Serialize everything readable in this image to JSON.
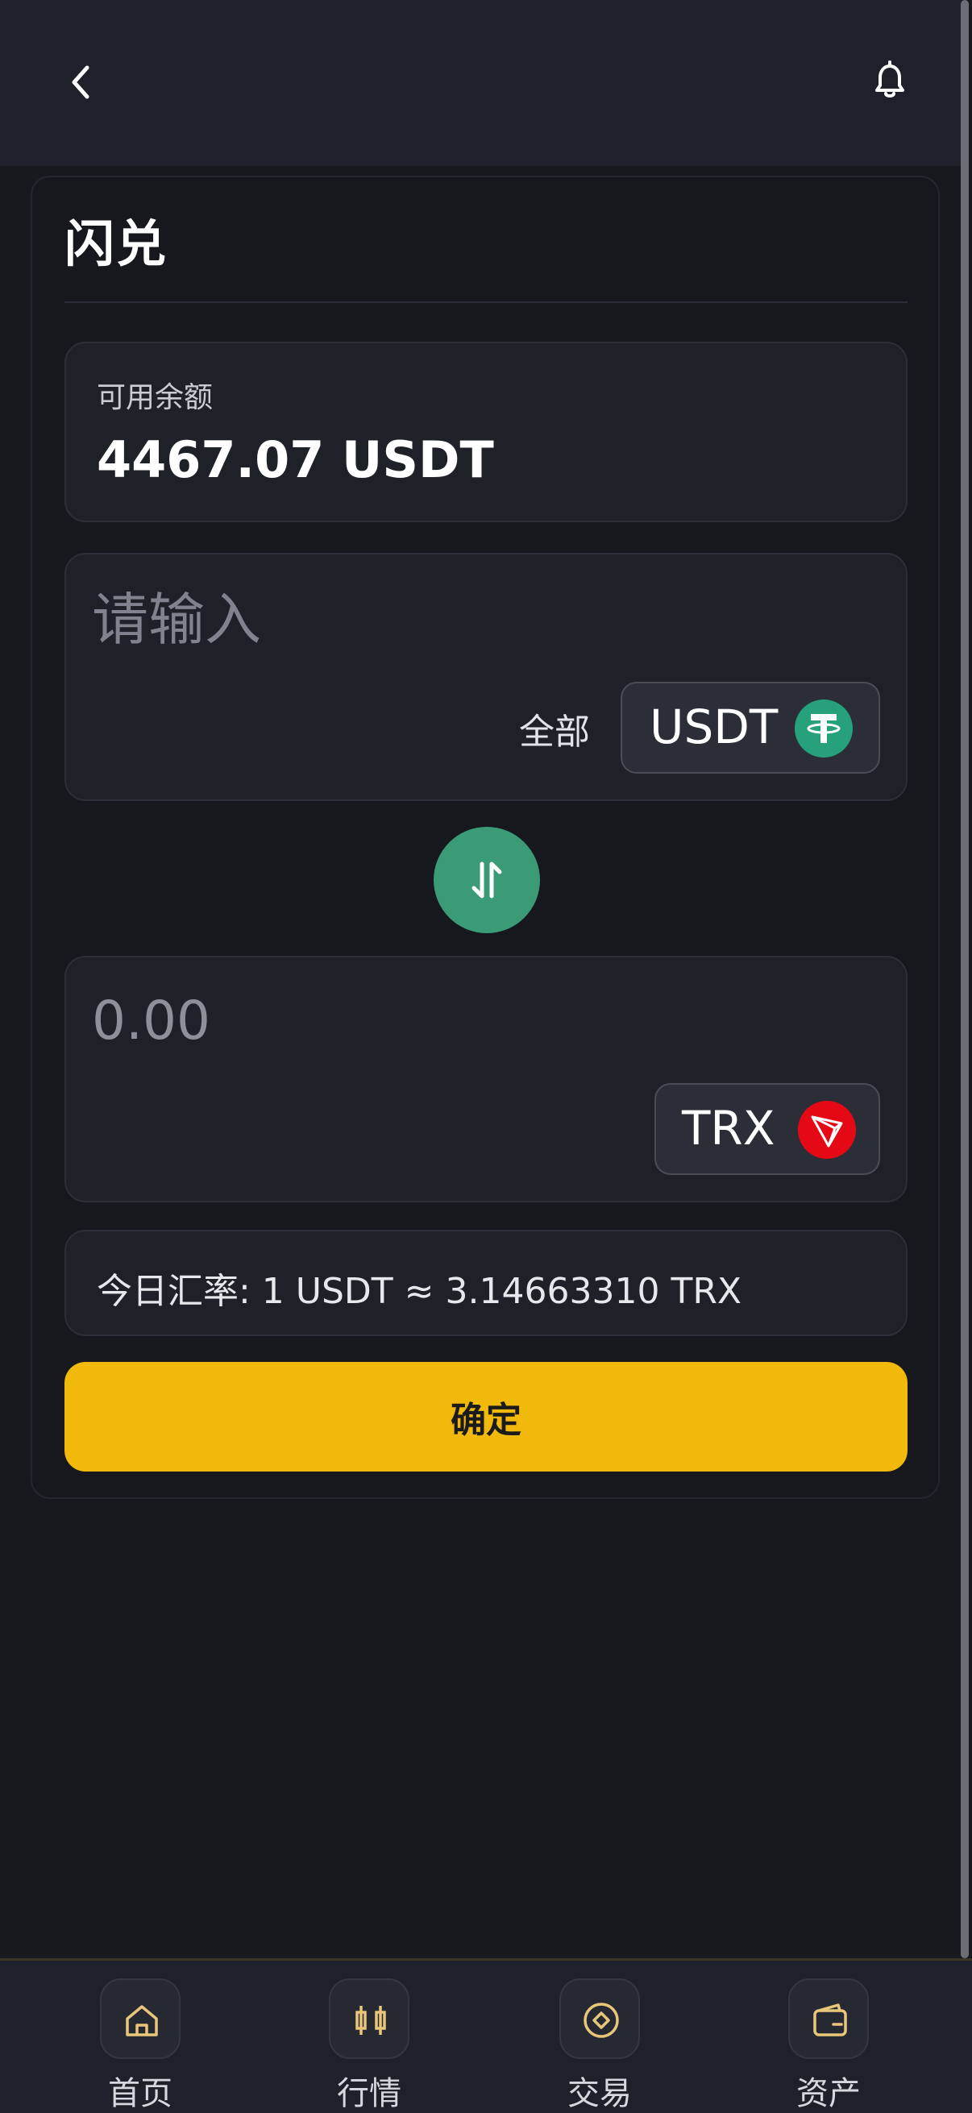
{
  "header": {
    "back_icon": "chevron-left-icon",
    "bell_icon": "bell-icon"
  },
  "page": {
    "title": "闪兑"
  },
  "balance": {
    "label": "可用余额",
    "value": "4467.07 USDT"
  },
  "from": {
    "placeholder": "请输入",
    "all_label": "全部",
    "separator": "|",
    "coin": "USDT",
    "coin_icon": "tether-icon",
    "coin_color": "#26a17b"
  },
  "swap": {
    "icon": "swap-vertical-icon",
    "color": "#3a9b76"
  },
  "to": {
    "amount": "0.00",
    "coin": "TRX",
    "coin_icon": "tron-icon",
    "coin_color": "#e50915"
  },
  "rate": {
    "text": "今日汇率: 1 USDT ≈ 3.14663310 TRX"
  },
  "confirm": {
    "label": "确定",
    "color": "#f0b90b"
  },
  "nav": {
    "items": [
      {
        "label": "首页",
        "icon": "home-icon"
      },
      {
        "label": "行情",
        "icon": "candlestick-icon"
      },
      {
        "label": "交易",
        "icon": "trade-icon"
      },
      {
        "label": "资产",
        "icon": "wallet-icon"
      }
    ],
    "icon_color": "#e8c77a"
  }
}
